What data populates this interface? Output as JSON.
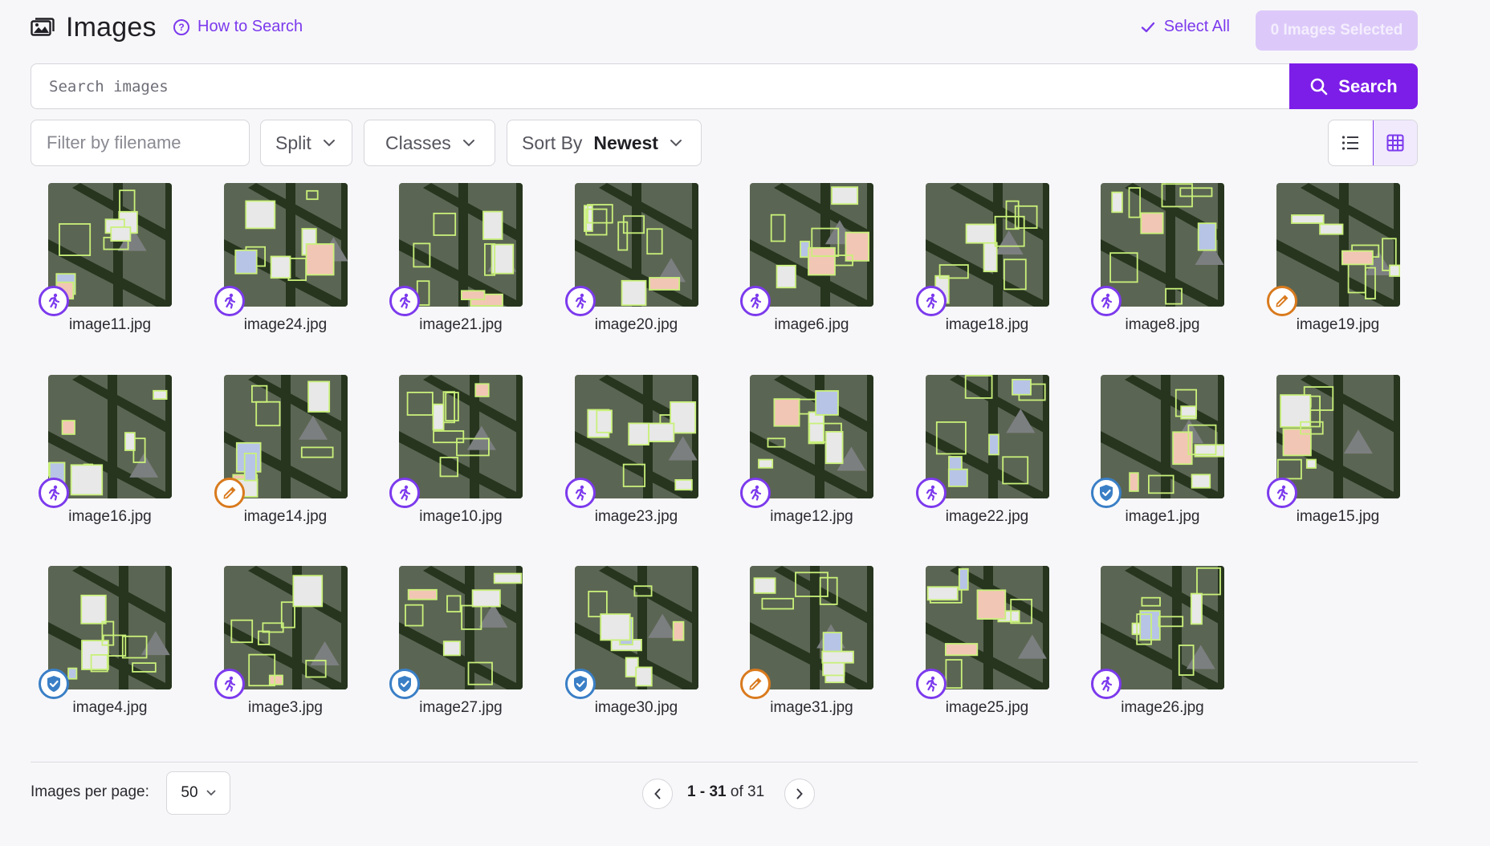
{
  "header": {
    "title": "Images",
    "how_to_search": "How to Search",
    "select_all": "Select All",
    "selected_count": "0 Images Selected"
  },
  "search": {
    "placeholder": "Search images",
    "button_label": "Search"
  },
  "filters": {
    "filename_placeholder": "Filter by filename",
    "split_label": "Split",
    "classes_label": "Classes",
    "sort_label": "Sort By",
    "sort_value": "Newest"
  },
  "view_modes": [
    "list",
    "grid"
  ],
  "active_view": "grid",
  "split_colors": {
    "train": "#7c3aed",
    "valid": "#3a7fc6",
    "test": "#d97a1d"
  },
  "images": [
    {
      "name": "image11.jpg",
      "split": "train"
    },
    {
      "name": "image24.jpg",
      "split": "train"
    },
    {
      "name": "image21.jpg",
      "split": "train"
    },
    {
      "name": "image20.jpg",
      "split": "train"
    },
    {
      "name": "image6.jpg",
      "split": "train"
    },
    {
      "name": "image18.jpg",
      "split": "train"
    },
    {
      "name": "image8.jpg",
      "split": "train"
    },
    {
      "name": "image19.jpg",
      "split": "test"
    },
    {
      "name": "image16.jpg",
      "split": "train"
    },
    {
      "name": "image14.jpg",
      "split": "test"
    },
    {
      "name": "image10.jpg",
      "split": "train"
    },
    {
      "name": "image23.jpg",
      "split": "train"
    },
    {
      "name": "image12.jpg",
      "split": "train"
    },
    {
      "name": "image22.jpg",
      "split": "train"
    },
    {
      "name": "image1.jpg",
      "split": "valid"
    },
    {
      "name": "image15.jpg",
      "split": "train"
    },
    {
      "name": "image4.jpg",
      "split": "valid"
    },
    {
      "name": "image3.jpg",
      "split": "train"
    },
    {
      "name": "image27.jpg",
      "split": "valid"
    },
    {
      "name": "image30.jpg",
      "split": "valid"
    },
    {
      "name": "image31.jpg",
      "split": "test"
    },
    {
      "name": "image25.jpg",
      "split": "train"
    },
    {
      "name": "image26.jpg",
      "split": "train"
    }
  ],
  "footer": {
    "per_page_label": "Images per page:",
    "per_page_value": "50",
    "range": "1 - 31",
    "of_label": "of",
    "total": "31"
  }
}
